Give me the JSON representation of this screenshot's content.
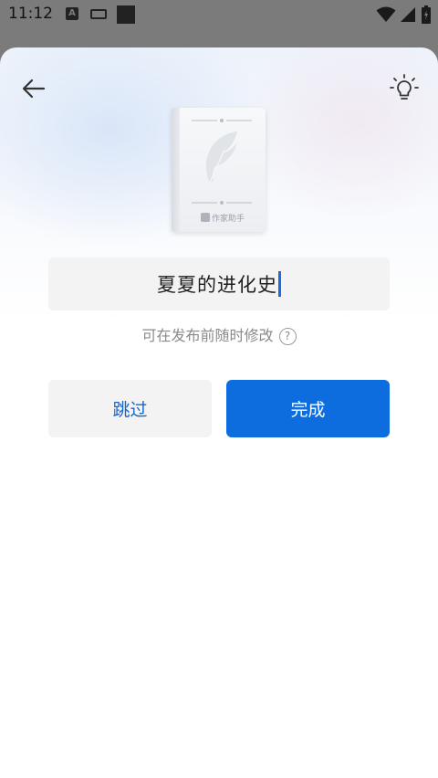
{
  "status_bar": {
    "time": "11:12",
    "notif_letter": "A",
    "icons": [
      "a-notification-icon",
      "keyboard-icon",
      "square-icon",
      "wifi-icon",
      "signal-icon",
      "battery-icon"
    ]
  },
  "header": {
    "back_icon": "arrow-left-icon",
    "tip_icon": "lightbulb-icon"
  },
  "cover": {
    "brand": "作家助手",
    "icon": "feather-icon"
  },
  "title_input": {
    "value": "夏夏的进化史"
  },
  "hint": {
    "text": "可在发布前随时修改",
    "help_icon": "?"
  },
  "buttons": {
    "skip_label": "跳过",
    "done_label": "完成"
  },
  "colors": {
    "accent": "#0d6ddf",
    "skip_text": "#1666c8",
    "field_bg": "#f3f3f3"
  }
}
